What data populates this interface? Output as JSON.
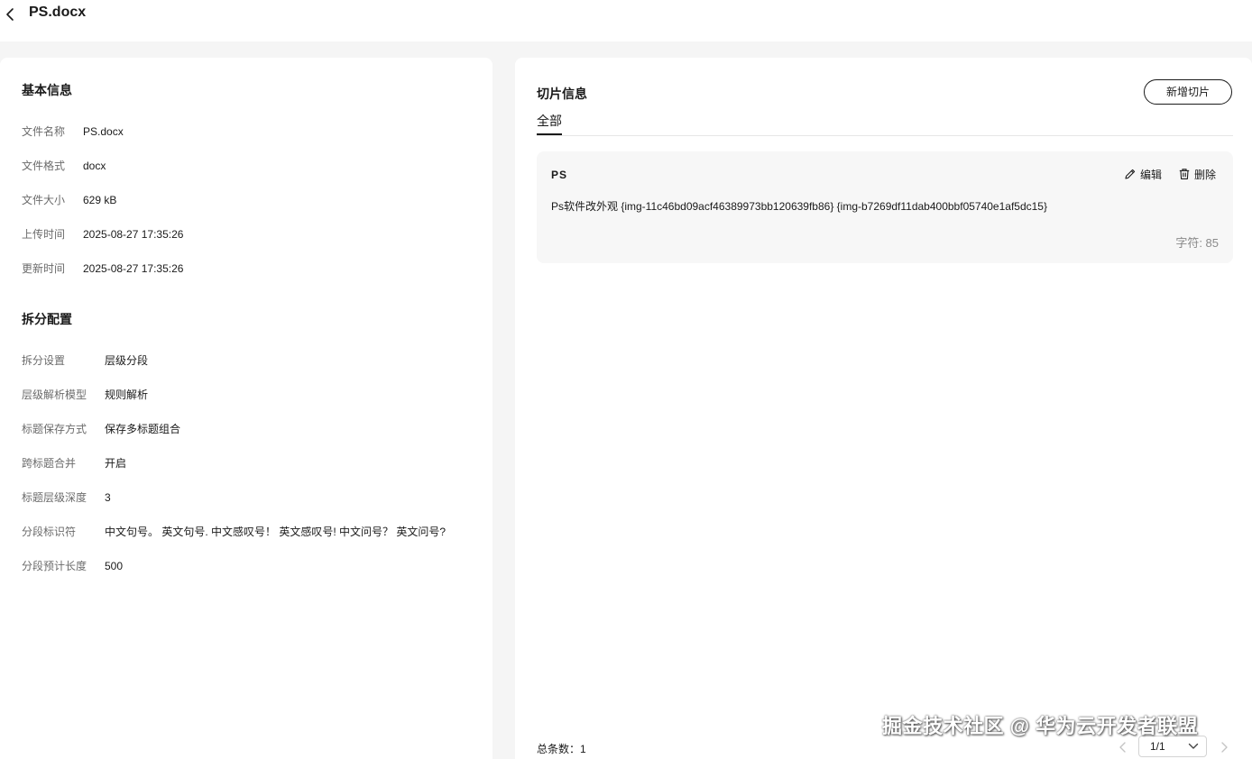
{
  "header": {
    "title": "PS.docx"
  },
  "basic_info": {
    "title": "基本信息",
    "rows": [
      {
        "key": "文件名称",
        "value": "PS.docx"
      },
      {
        "key": "文件格式",
        "value": "docx"
      },
      {
        "key": "文件大小",
        "value": "629 kB"
      },
      {
        "key": "上传时间",
        "value": "2025-08-27 17:35:26"
      },
      {
        "key": "更新时间",
        "value": "2025-08-27 17:35:26"
      }
    ]
  },
  "split_config": {
    "title": "拆分配置",
    "rows": [
      {
        "key": "拆分设置",
        "value": "层级分段"
      },
      {
        "key": "层级解析模型",
        "value": "规则解析"
      },
      {
        "key": "标题保存方式",
        "value": "保存多标题组合"
      },
      {
        "key": "跨标题合并",
        "value": "开启"
      },
      {
        "key": "标题层级深度",
        "value": "3"
      },
      {
        "key": "分段标识符",
        "value": "中文句号。 英文句号. 中文感叹号！ 英文感叹号! 中文问号？ 英文问号?"
      },
      {
        "key": "分段预计长度",
        "value": "500"
      }
    ]
  },
  "slices": {
    "title": "切片信息",
    "add_button": "新增切片",
    "tab_all": "全部",
    "items": [
      {
        "title": "PS",
        "edit_label": "编辑",
        "delete_label": "删除",
        "content": "Ps软件改外观 {img-11c46bd09acf46389973bb120639fb86} {img-b7269df11dab400bbf05740e1af5dc15}",
        "chars": "字符: 85"
      }
    ],
    "total": "总条数：1",
    "page": "1/1"
  },
  "watermark": "掘金技术社区 @ 华为云开发者联盟",
  "colors": {
    "accent": "#1a1a1a",
    "background": "#f5f5f5",
    "card": "#f7f7f7"
  }
}
